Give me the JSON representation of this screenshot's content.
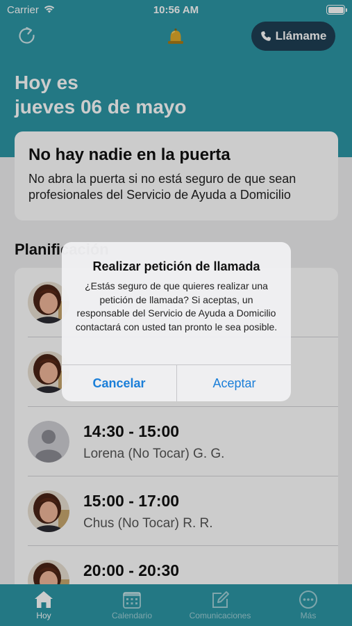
{
  "status_bar": {
    "carrier": "Carrier",
    "time": "10:56 AM"
  },
  "header": {
    "refresh_icon": "refresh-icon",
    "bell_icon": "bell-icon",
    "call_button": {
      "icon": "phone-icon",
      "label": "Llámame"
    },
    "today_line1": "Hoy es",
    "today_line2": "jueves 06 de mayo"
  },
  "door_card": {
    "title": "No hay nadie en la puerta",
    "description": "No abra la puerta si no está seguro de que sean profesionales del Servicio de Ayuda a Domicilio"
  },
  "schedule": {
    "section_title": "Planificación",
    "rows": [
      {
        "time": "",
        "name": "",
        "avatar": "photo"
      },
      {
        "time": "",
        "name": "",
        "avatar": "photo"
      },
      {
        "time": "14:30 - 15:00",
        "name": "Lorena (No Tocar) G. G.",
        "avatar": "placeholder"
      },
      {
        "time": "15:00 - 17:00",
        "name": "Chus (No Tocar) R. R.",
        "avatar": "photo"
      },
      {
        "time": "20:00 - 20:30",
        "name": "",
        "avatar": "photo"
      }
    ]
  },
  "alert": {
    "title": "Realizar petición de llamada",
    "message": "¿Estás seguro de que quieres realizar una petición de llamada? Si aceptas, un responsable del Servicio de Ayuda a Domicilio contactará con usted tan pronto le sea posible.",
    "cancel_label": "Cancelar",
    "accept_label": "Aceptar"
  },
  "tabbar": {
    "tabs": [
      {
        "label": "Hoy",
        "icon": "home-icon",
        "active": true
      },
      {
        "label": "Calendario",
        "icon": "calendar-icon",
        "active": false
      },
      {
        "label": "Comunicaciones",
        "icon": "compose-icon",
        "active": false
      },
      {
        "label": "Más",
        "icon": "more-icon",
        "active": false
      }
    ]
  },
  "colors": {
    "teal": "#2c97a6",
    "navy_button": "#1f3f54",
    "alert_button": "#1a7ed8"
  }
}
